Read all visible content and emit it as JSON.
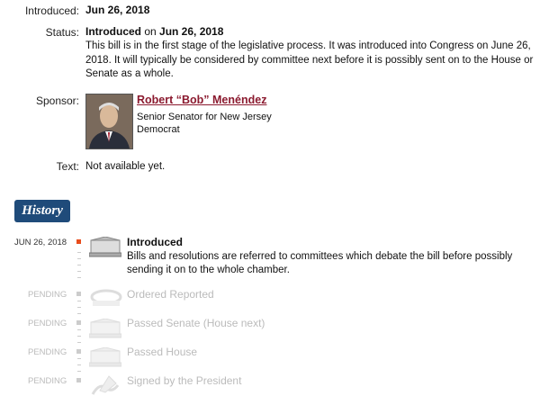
{
  "overview": {
    "introduced_label": "Introduced:",
    "introduced_date": "Jun 26, 2018",
    "status_label": "Status:",
    "status_stage": "Introduced",
    "status_on": " on ",
    "status_date": "Jun 26, 2018",
    "status_desc": "This bill is in the first stage of the legislative process. It was introduced into Congress on June 26, 2018. It will typically be considered by committee next before it is possibly sent on to the House or Senate as a whole.",
    "sponsor_label": "Sponsor:",
    "sponsor_name": "Robert “Bob” Menéndez",
    "sponsor_role": "Senior Senator for New Jersey",
    "sponsor_party": "Democrat",
    "text_label": "Text:",
    "text_value": "Not available yet."
  },
  "history": {
    "heading": "History",
    "steps": [
      {
        "date": "JUN 26, 2018",
        "title": "Introduced",
        "desc": "Bills and resolutions are referred to committees which debate the bill before possibly sending it on to the whole chamber.",
        "icon": "capitol-building-icon",
        "state": "current"
      },
      {
        "date": "PENDING",
        "title": "Ordered Reported",
        "icon": "committee-table-icon",
        "state": "pending"
      },
      {
        "date": "PENDING",
        "title": "Passed Senate (House next)",
        "icon": "capitol-building-icon",
        "state": "pending"
      },
      {
        "date": "PENDING",
        "title": "Passed House",
        "icon": "capitol-building-icon",
        "state": "pending"
      },
      {
        "date": "PENDING",
        "title": "Signed by the President",
        "icon": "pen-signature-icon",
        "state": "pending"
      }
    ]
  },
  "colors": {
    "accent": "#1f4b7a",
    "link": "#8b1a2f",
    "current_dot": "#e84d1c",
    "pending": "#bbbbbb"
  }
}
